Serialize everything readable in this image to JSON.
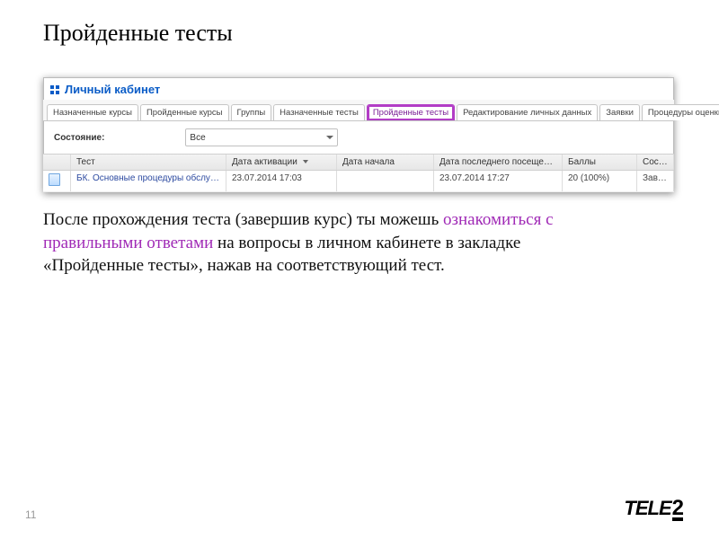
{
  "slide": {
    "title": "Пройденные тесты",
    "page_number": "11"
  },
  "cab_header": "Личный кабинет",
  "tabs": [
    "Назначенные курсы",
    "Пройденные курсы",
    "Группы",
    "Назначенные тесты",
    "Пройденные тесты",
    "Редактирование личных данных",
    "Заявки",
    "Процедуры оценки"
  ],
  "active_tab_index": 4,
  "filter": {
    "label": "Состояние:",
    "value": "Все"
  },
  "columns": {
    "test": "Тест",
    "activation": "Дата активации",
    "start": "Дата начала",
    "last_visit": "Дата последнего посещения",
    "score": "Баллы",
    "state": "Состояние"
  },
  "row": {
    "test": "БК. Основные процедуры обслужи…",
    "activation": "23.07.2014 17:03",
    "start": "",
    "last_visit": "23.07.2014 17:27",
    "score": "20 (100%)",
    "state": "Завершен"
  },
  "body": {
    "part1": "После прохождения теста (завершив курс) ты можешь ",
    "highlight": "ознакомиться с правильными ответами",
    "part2": " на вопросы в личном кабинете в закладке «Пройденные тесты», нажав на соответствующий тест."
  },
  "brand": {
    "text": "TELE",
    "suffix": "2"
  }
}
